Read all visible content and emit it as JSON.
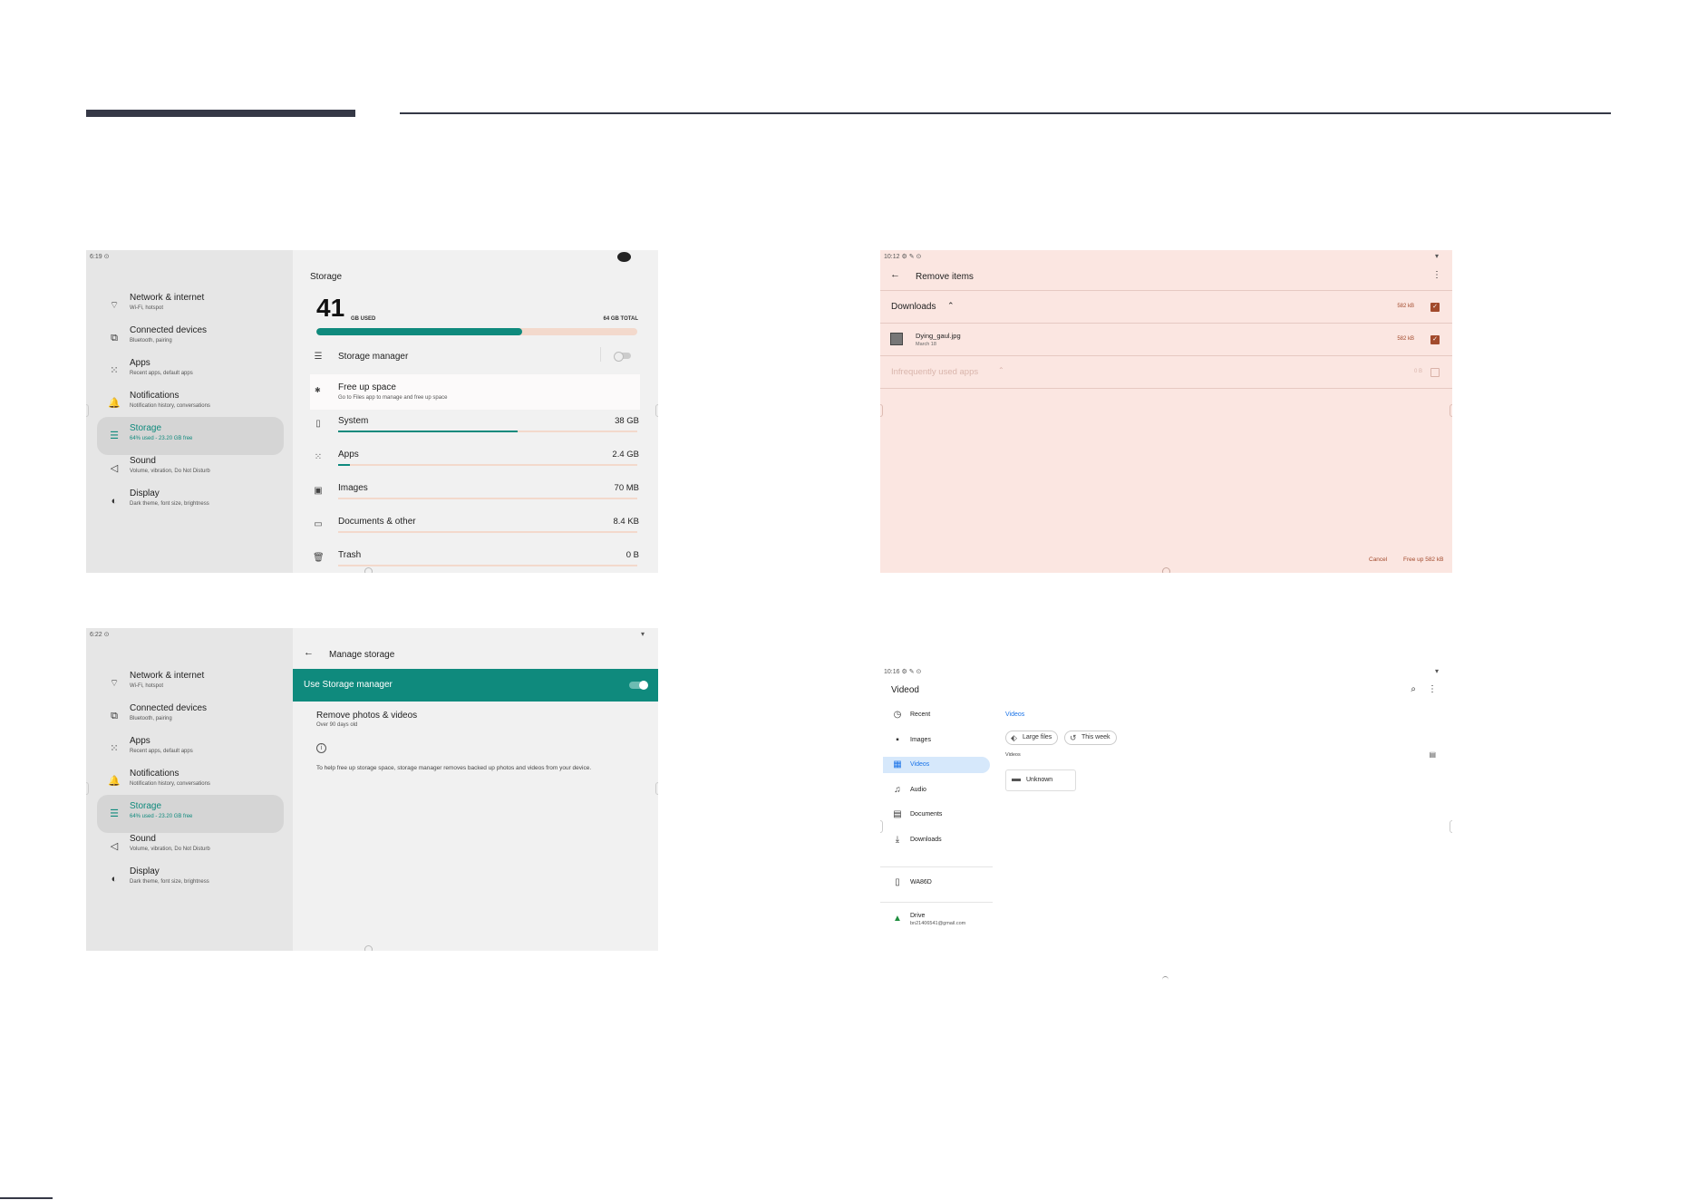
{
  "shot1": {
    "time": "6:19",
    "sidebar": [
      {
        "label": "Network & internet",
        "sub": "Wi-Fi, hotspot",
        "icon": "wifi-icon"
      },
      {
        "label": "Connected devices",
        "sub": "Bluetooth, pairing",
        "icon": "devices-icon"
      },
      {
        "label": "Apps",
        "sub": "Recent apps, default apps",
        "icon": "apps-grid-icon"
      },
      {
        "label": "Notifications",
        "sub": "Notification history, conversations",
        "icon": "bell-icon"
      },
      {
        "label": "Storage",
        "sub": "64% used - 23.20 GB free",
        "icon": "storage-icon",
        "active": true
      },
      {
        "label": "Sound",
        "sub": "Volume, vibration, Do Not Disturb",
        "icon": "speaker-icon"
      },
      {
        "label": "Display",
        "sub": "Dark theme, font size, brightness",
        "icon": "display-icon"
      }
    ],
    "title": "Storage",
    "used_number": "41",
    "used_label": "GB USED",
    "total_label": "64 GB TOTAL",
    "used_fraction": 0.64,
    "storage_manager_label": "Storage manager",
    "free_up_title": "Free up space",
    "free_up_sub": "Go to Files app to manage and free up space",
    "categories": [
      {
        "label": "System",
        "value": "38 GB",
        "fraction": 0.6,
        "icon": "phone-icon"
      },
      {
        "label": "Apps",
        "value": "2.4 GB",
        "fraction": 0.04,
        "icon": "apps-grid-icon"
      },
      {
        "label": "Images",
        "value": "70 MB",
        "fraction": 0,
        "icon": "images-icon"
      },
      {
        "label": "Documents & other",
        "value": "8.4 KB",
        "fraction": 0,
        "icon": "folder-icon"
      },
      {
        "label": "Trash",
        "value": "0 B",
        "fraction": 0,
        "icon": "trash-icon"
      }
    ]
  },
  "shot2": {
    "time": "10:12",
    "title": "Remove items",
    "downloads_label": "Downloads",
    "downloads_size": "582 kB",
    "file_name": "Dying_gaul.jpg",
    "file_date": "March 18",
    "file_size": "582 kB",
    "infrequent_label": "Infrequently used apps",
    "infrequent_size": "0 B",
    "cancel_label": "Cancel",
    "free_up_label": "Free up 582 kB"
  },
  "shot3": {
    "time": "6:22",
    "sidebar": [
      {
        "label": "Network & internet",
        "sub": "Wi-Fi, hotspot",
        "icon": "wifi-icon"
      },
      {
        "label": "Connected devices",
        "sub": "Bluetooth, pairing",
        "icon": "devices-icon"
      },
      {
        "label": "Apps",
        "sub": "Recent apps, default apps",
        "icon": "apps-grid-icon"
      },
      {
        "label": "Notifications",
        "sub": "Notification history, conversations",
        "icon": "bell-icon"
      },
      {
        "label": "Storage",
        "sub": "64% used - 23.20 GB free",
        "icon": "storage-icon",
        "active": true
      },
      {
        "label": "Sound",
        "sub": "Volume, vibration, Do Not Disturb",
        "icon": "speaker-icon"
      },
      {
        "label": "Display",
        "sub": "Dark theme, font size, brightness",
        "icon": "display-icon"
      }
    ],
    "title": "Manage storage",
    "use_manager_label": "Use Storage manager",
    "remove_title": "Remove photos & videos",
    "remove_sub": "Over 90 days old",
    "info_text": "To help free up storage space, storage manager removes backed up photos and videos from your device."
  },
  "shot4": {
    "time": "10:16",
    "app_title": "Videod",
    "nav": [
      {
        "label": "Recent",
        "icon": "clock-icon"
      },
      {
        "label": "Images",
        "icon": "image-icon"
      },
      {
        "label": "Videos",
        "icon": "video-icon",
        "active": true
      },
      {
        "label": "Audio",
        "icon": "audio-icon"
      },
      {
        "label": "Documents",
        "icon": "document-icon"
      },
      {
        "label": "Downloads",
        "icon": "download-icon"
      }
    ],
    "device_label": "WA86D",
    "drive_label": "Drive",
    "drive_account": "bn21406541@gmail.com",
    "breadcrumb": "Videos",
    "chip_large": "Large files",
    "chip_week": "This week",
    "section_label": "Videos",
    "folder_label": "Unknown"
  },
  "colors": {
    "accent": "#0f8a7d",
    "header_dark": "#353846",
    "pink_bg": "#fbe6e1",
    "pink_accent": "#a24a2c",
    "files_blue": "#1a73e8"
  }
}
